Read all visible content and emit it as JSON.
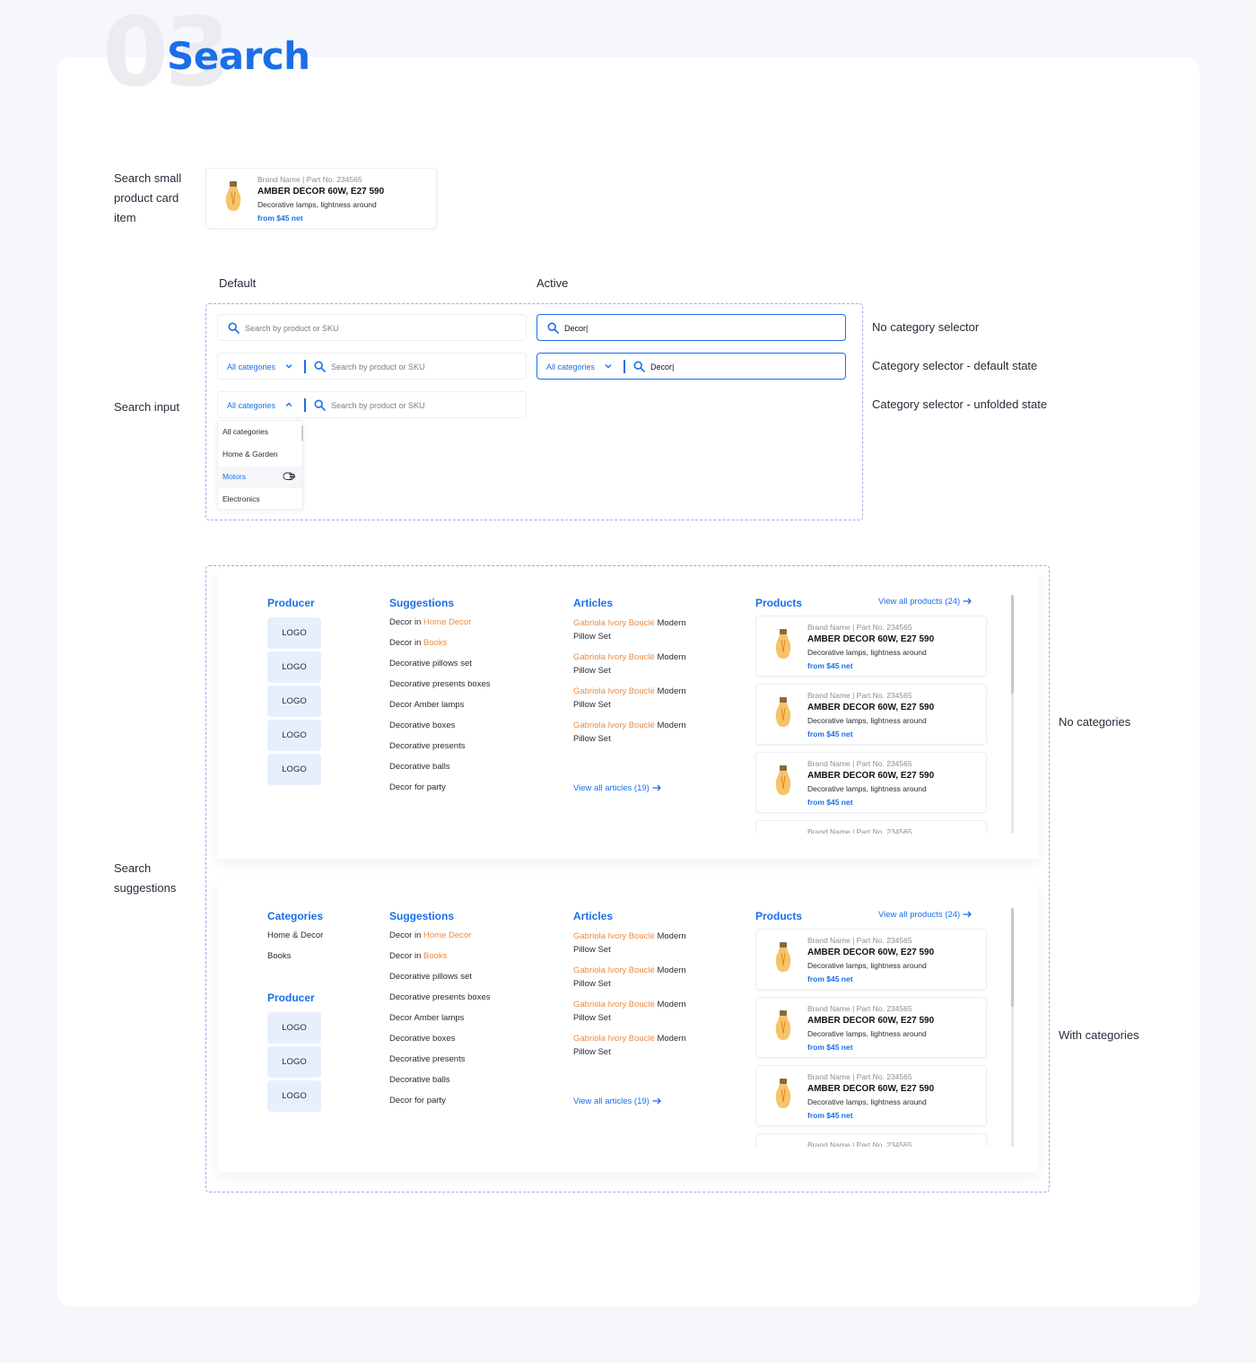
{
  "header": {
    "number": "03",
    "title": "Search"
  },
  "labels": {
    "small_card": [
      "Search small",
      "product card",
      "item"
    ],
    "search_input": "Search input",
    "search_suggestions": [
      "Search",
      "suggestions"
    ],
    "default": "Default",
    "active": "Active",
    "no_category": "No category selector",
    "cat_default": "Category selector - default state",
    "cat_unfolded": "Category selector - unfolded state",
    "no_categories": "No categories",
    "with_categories": "With categories"
  },
  "product": {
    "meta": "Brand Name | Part No. 234565",
    "name": "AMBER DECOR 60W, E27 590",
    "desc": "Decorative lamps, lightness around",
    "price": "from $45 net",
    "icon": "lightbulb-icon"
  },
  "search": {
    "placeholder": "Search by product or SKU",
    "typed": "Decor|",
    "category": "All categories",
    "dropdown": [
      "All categories",
      "Home & Garden",
      "Motors",
      "Electronics"
    ]
  },
  "suggestions": {
    "producer_title": "Producer",
    "categories_title": "Categories",
    "suggestions_title": "Suggestions",
    "articles_title": "Articles",
    "products_title": "Products",
    "view_all_products": "View all products (24)",
    "view_all_articles": "View all articles (19)",
    "logo": "LOGO",
    "categories": [
      "Home & Decor",
      "Books"
    ],
    "in_word": "in",
    "items": [
      {
        "pre": "Decor",
        "cat": "Home Decor"
      },
      {
        "pre": "Decor",
        "cat": "Books"
      },
      {
        "text": "Decorative pillows set"
      },
      {
        "text": "Decorative presents boxes"
      },
      {
        "text": "Decor Amber lamps"
      },
      {
        "text": "Decorative boxes"
      },
      {
        "text": "Decorative presents"
      },
      {
        "text": "Decorative balls"
      },
      {
        "text": "Decor for party"
      }
    ],
    "article_highlight": "Gabriola Ivory Bouclé",
    "article_rest": "Modern Pillow Set"
  },
  "colors": {
    "accent": "#1a6fe8",
    "orange": "#f08a3c",
    "dash": "#a7a4ef",
    "logo_bg": "#e7effd"
  }
}
